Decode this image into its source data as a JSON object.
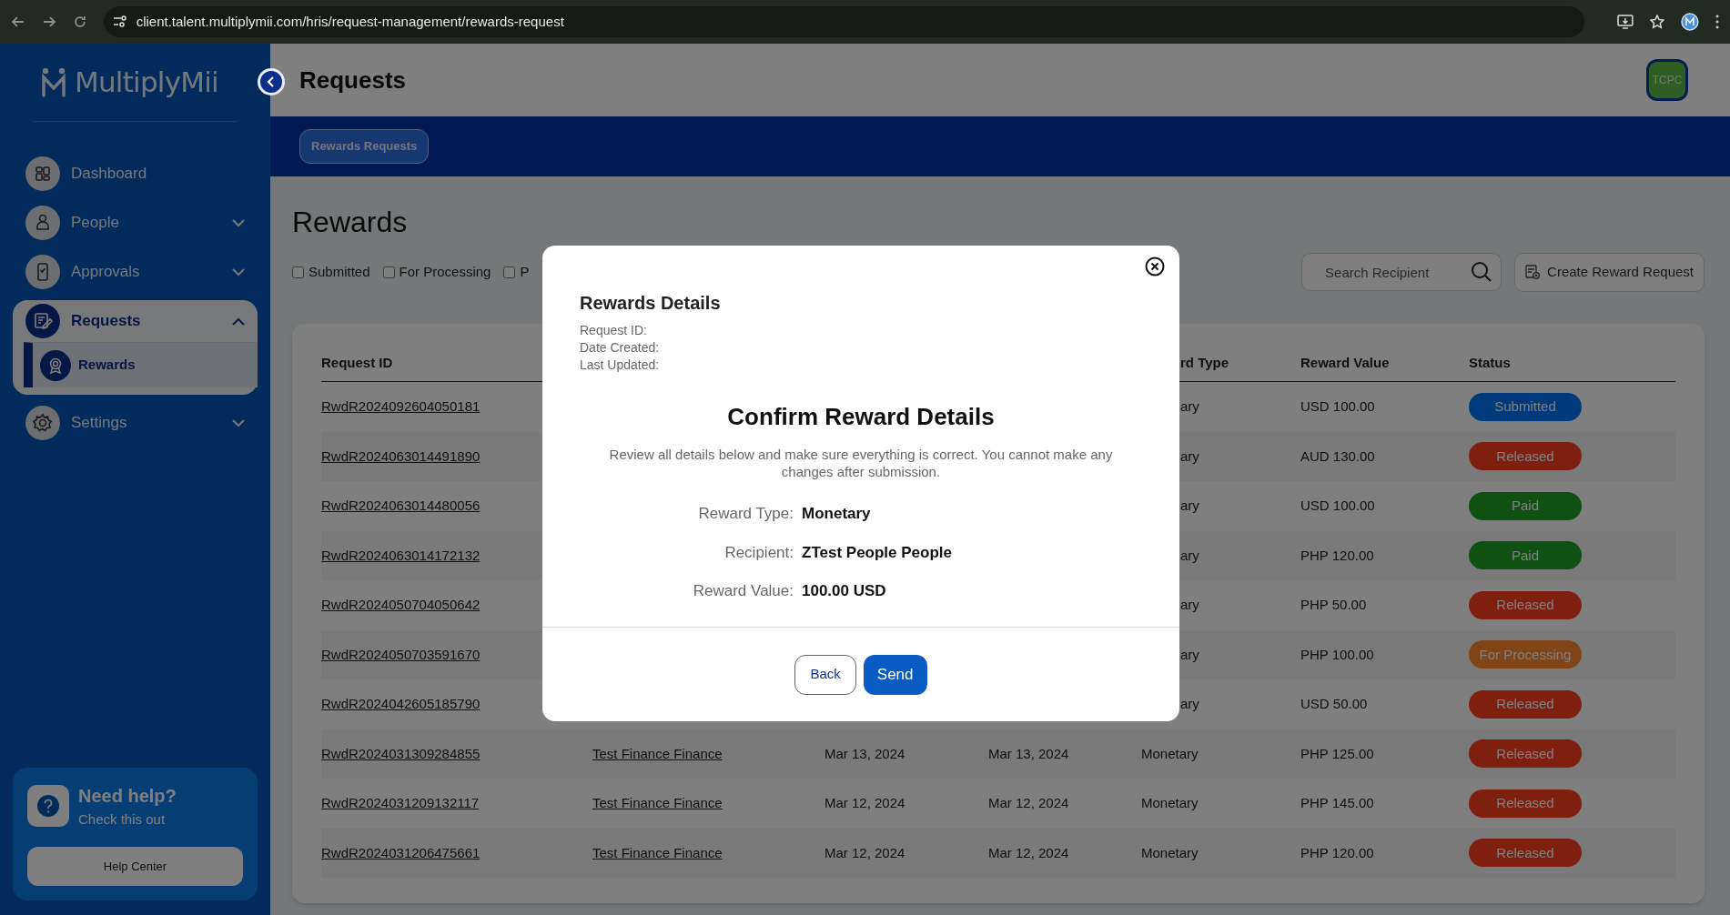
{
  "browser": {
    "url": "client.talent.multiplymii.com/hris/request-management/rewards-request"
  },
  "sidebar": {
    "logo": "MultiplyMii",
    "items": [
      {
        "label": "Dashboard",
        "selected": false
      },
      {
        "label": "People",
        "selected": false,
        "expanded": false
      },
      {
        "label": "Approvals",
        "selected": false,
        "expanded": false
      },
      {
        "label": "Requests",
        "selected": true,
        "expanded": true,
        "children": [
          {
            "label": "Rewards",
            "selected": true
          }
        ]
      },
      {
        "label": "Settings",
        "selected": false,
        "expanded": false
      }
    ],
    "help": {
      "title": "Need help?",
      "subtitle": "Check this out",
      "button": "Help Center"
    }
  },
  "header": {
    "title": "Requests",
    "avatar": "TCPC"
  },
  "tabs": [
    {
      "label": "Rewards Requests",
      "selected": true
    }
  ],
  "page": {
    "title": "Rewards",
    "filters": [
      {
        "label": "Submitted",
        "checked": false
      },
      {
        "label": "For Processing",
        "checked": false
      },
      {
        "label": "P",
        "checked": false
      }
    ],
    "search": {
      "placeholder": "Search Recipient"
    },
    "create_button": "Create Reward Request"
  },
  "table": {
    "columns": [
      {
        "label": "Request ID"
      },
      {
        "label": "rd Type"
      },
      {
        "label": "Reward Value"
      },
      {
        "label": "Status"
      }
    ],
    "rows": [
      {
        "request_id": "RwdR2024092604050181",
        "reward_type": "ary",
        "reward_value": "USD 100.00",
        "status": "Submitted",
        "color": "#003a7a"
      },
      {
        "request_id": "RwdR2024063014491890",
        "reward_type": "ary",
        "reward_value": "AUD 130.00",
        "status": "Released",
        "color": "#7f1f10"
      },
      {
        "request_id": "RwdR2024063014480056",
        "reward_type": "ary",
        "reward_value": "USD 100.00",
        "status": "Paid",
        "color": "#0f5013"
      },
      {
        "request_id": "RwdR2024063014172132",
        "reward_type": "ary",
        "reward_value": "PHP 120.00",
        "status": "Paid",
        "color": "#0f5013"
      },
      {
        "request_id": "RwdR2024050704050642",
        "reward_type": "ary",
        "reward_value": "PHP 50.00",
        "status": "Released",
        "color": "#7f1f10"
      },
      {
        "request_id": "RwdR2024050703591670",
        "reward_type": "ary",
        "reward_value": "PHP 100.00",
        "status": "For Processing",
        "color": "#7f4418"
      },
      {
        "request_id": "RwdR2024042605185790",
        "reward_type": "ary",
        "reward_value": "USD 50.00",
        "status": "Released",
        "color": "#7f1f10"
      },
      {
        "request_id": "RwdR2024031309284855",
        "recipient": "Test Finance Finance",
        "date_created": "Mar 13, 2024",
        "last_updated": "Mar 13, 2024",
        "reward_type": "Monetary",
        "reward_value": "PHP 125.00",
        "status": "Released",
        "color": "#7f1f10"
      },
      {
        "request_id": "RwdR2024031209132117",
        "recipient": "Test Finance Finance",
        "date_created": "Mar 12, 2024",
        "last_updated": "Mar 12, 2024",
        "reward_type": "Monetary",
        "reward_value": "PHP 145.00",
        "status": "Released",
        "color": "#7f1f10"
      },
      {
        "request_id": "RwdR2024031206475661",
        "recipient": "Test Finance Finance",
        "date_created": "Mar 12, 2024",
        "last_updated": "Mar 12, 2024",
        "reward_type": "Monetary",
        "reward_value": "PHP 120.00",
        "status": "Released",
        "color": "#7f1f10"
      }
    ]
  },
  "modal": {
    "title": "Rewards Details",
    "meta": [
      "Request ID:",
      "Date Created:",
      "Last Updated:"
    ],
    "heading": "Confirm Reward Details",
    "message": "Review all details below and make sure everything is correct. You cannot make any changes after submission.",
    "details": [
      {
        "label": "Reward Type:",
        "value": "Monetary"
      },
      {
        "label": "Recipient:",
        "value": "ZTest People People"
      },
      {
        "label": "Reward Value:",
        "value": "100.00 USD"
      }
    ],
    "buttons": [
      {
        "label": "Back",
        "kind": "secondary"
      },
      {
        "label": "Send",
        "kind": "primary"
      }
    ]
  }
}
